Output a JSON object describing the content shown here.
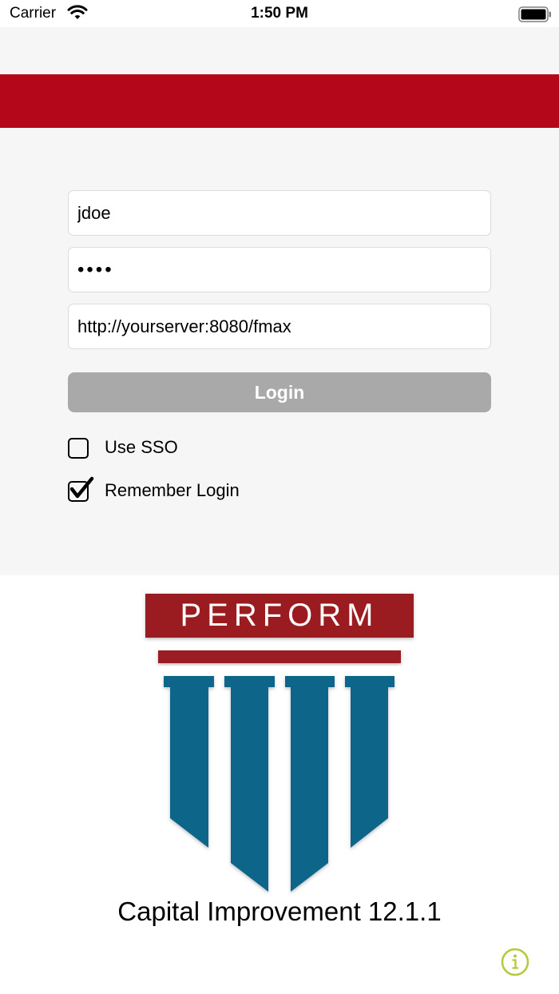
{
  "status_bar": {
    "carrier": "Carrier",
    "time": "1:50 PM"
  },
  "login": {
    "username_value": "jdoe",
    "password_value": "pass",
    "server_value": "http://yourserver:8080/fmax",
    "login_label": "Login",
    "use_sso_label": "Use SSO",
    "use_sso_checked": false,
    "remember_label": "Remember Login",
    "remember_checked": true
  },
  "logo": {
    "text": "PERFORM"
  },
  "product": {
    "title": "Capital Improvement 12.1.1"
  },
  "icons": {
    "wifi": "wifi-icon",
    "battery": "battery-icon",
    "info": "info-icon",
    "checkmark": "checkmark-icon"
  },
  "colors": {
    "brand_red": "#b4071a",
    "logo_red": "#9b1c20",
    "logo_blue": "#10668a",
    "info_green": "#b5c93a",
    "button_disabled": "#a9a9a9",
    "background": "#f6f6f6"
  }
}
